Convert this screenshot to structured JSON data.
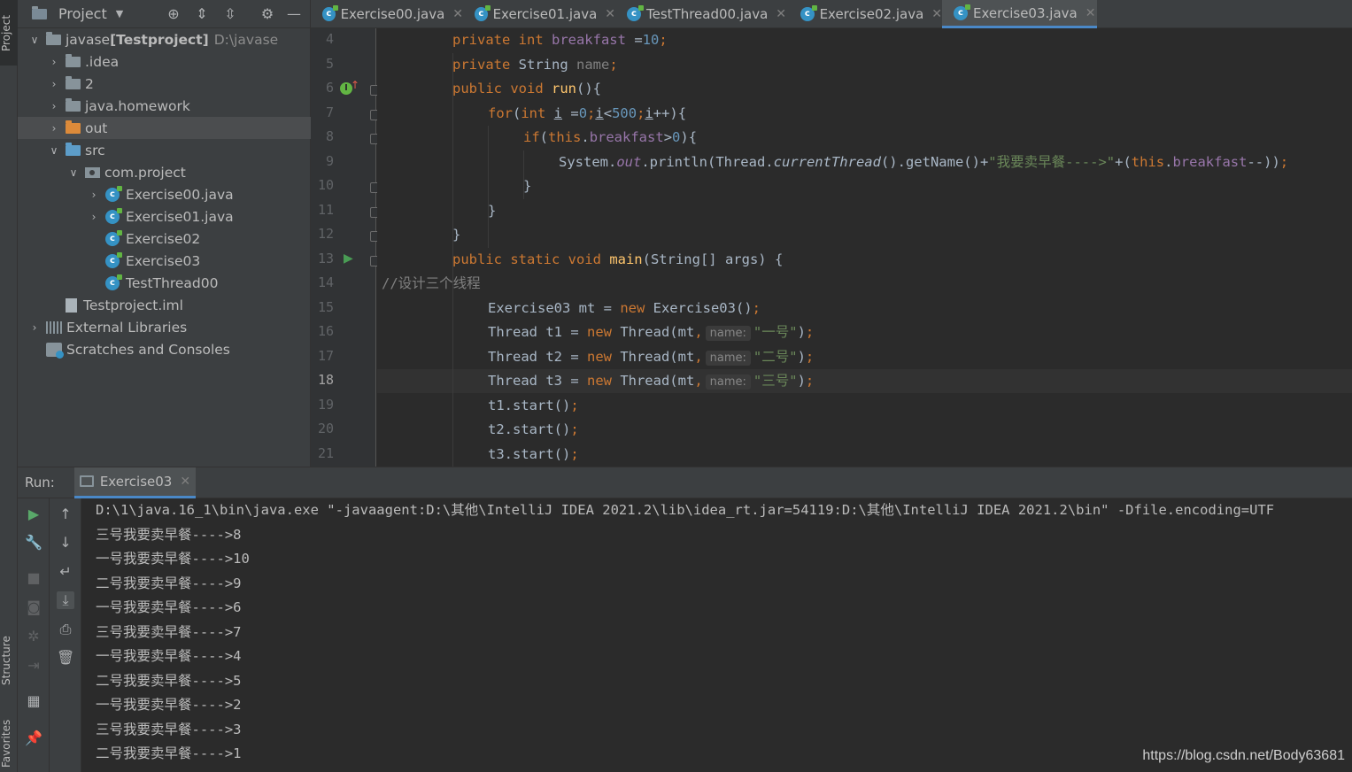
{
  "left_stripe": {
    "project": "Project",
    "structure": "Structure",
    "favorites": "Favorites"
  },
  "project": {
    "title": "Project",
    "tree": [
      {
        "name": "javase",
        "bold_suffix": "[Testproject]",
        "path": "D:\\javase",
        "icon": "folder-icon"
      },
      {
        "name": ".idea",
        "icon": "folder-icon"
      },
      {
        "name": "2",
        "icon": "folder-icon"
      },
      {
        "name": "java.homework",
        "icon": "folder-icon"
      },
      {
        "name": "out",
        "icon": "excluded-folder-icon"
      },
      {
        "name": "src",
        "icon": "source-folder-icon"
      },
      {
        "name": "com.project",
        "icon": "package-icon"
      },
      {
        "name": "Exercise00.java",
        "icon": "java-class-icon"
      },
      {
        "name": "Exercise01.java",
        "icon": "java-class-icon"
      },
      {
        "name": "Exercise02",
        "icon": "java-class-icon"
      },
      {
        "name": "Exercise03",
        "icon": "java-class-icon"
      },
      {
        "name": "TestThread00",
        "icon": "java-class-icon"
      },
      {
        "name": "Testproject.iml",
        "icon": "module-file-icon"
      },
      {
        "name": "External Libraries",
        "icon": "libraries-icon"
      },
      {
        "name": "Scratches and Consoles",
        "icon": "scratches-icon"
      }
    ]
  },
  "tabs": [
    "Exercise00.java",
    "Exercise01.java",
    "TestThread00.java",
    "Exercise02.java",
    "Exercise03.java"
  ],
  "active_tab": "Exercise03.java",
  "editor": {
    "line_numbers": [
      "4",
      "5",
      "6",
      "7",
      "8",
      "9",
      "10",
      "11",
      "12",
      "13",
      "14",
      "15",
      "16",
      "17",
      "18",
      "19",
      "20",
      "21"
    ],
    "current_line": "18",
    "lines": [
      [
        {
          "c": "k",
          "t": "private int "
        },
        {
          "c": "f",
          "t": "breakfast"
        },
        {
          "t": " ="
        },
        {
          "c": "n",
          "t": "10"
        },
        {
          "c": "k",
          "t": ";"
        }
      ],
      [
        {
          "c": "k",
          "t": "private "
        },
        {
          "t": "String "
        },
        {
          "c": "g",
          "t": "name"
        },
        {
          "c": "k",
          "t": ";"
        }
      ],
      [
        {
          "c": "k",
          "t": "public void "
        },
        {
          "c": "m",
          "t": "run"
        },
        {
          "t": "(){"
        }
      ],
      [
        {
          "c": "k",
          "t": "for"
        },
        {
          "t": "("
        },
        {
          "c": "k",
          "t": "int "
        },
        {
          "c": "u",
          "t": "i"
        },
        {
          "t": " ="
        },
        {
          "c": "n",
          "t": "0"
        },
        {
          "c": "k",
          "t": ";"
        },
        {
          "c": "u",
          "t": "i"
        },
        {
          "t": "<"
        },
        {
          "c": "n",
          "t": "500"
        },
        {
          "c": "k",
          "t": ";"
        },
        {
          "c": "u",
          "t": "i"
        },
        {
          "t": "++){"
        }
      ],
      [
        {
          "c": "k",
          "t": "if"
        },
        {
          "t": "("
        },
        {
          "c": "k",
          "t": "this"
        },
        {
          "t": "."
        },
        {
          "c": "f",
          "t": "breakfast"
        },
        {
          "t": ">"
        },
        {
          "c": "n",
          "t": "0"
        },
        {
          "t": "){"
        }
      ],
      [
        {
          "t": "System."
        },
        {
          "c": "fi",
          "t": "out"
        },
        {
          "t": ".println(Thread."
        },
        {
          "c": "it",
          "t": "currentThread"
        },
        {
          "t": "().getName()+"
        },
        {
          "c": "s",
          "t": "\"我要卖早餐---->\""
        },
        {
          "t": "+("
        },
        {
          "c": "k",
          "t": "this"
        },
        {
          "t": "."
        },
        {
          "c": "f",
          "t": "breakfast"
        },
        {
          "t": "--))"
        },
        {
          "c": "k",
          "t": ";"
        }
      ],
      [
        {
          "t": "}"
        }
      ],
      [
        {
          "t": "}"
        }
      ],
      [
        {
          "t": "}"
        }
      ],
      [
        {
          "c": "k",
          "t": "public static void "
        },
        {
          "c": "m",
          "t": "main"
        },
        {
          "t": "(String[] args) {"
        }
      ],
      [
        {
          "c": "g",
          "t": "//设计三个线程"
        }
      ],
      [
        {
          "t": "Exercise03 mt = "
        },
        {
          "c": "k",
          "t": "new "
        },
        {
          "t": "Exercise03()"
        },
        {
          "c": "k",
          "t": ";"
        }
      ],
      [
        {
          "t": "Thread t1 = "
        },
        {
          "c": "k",
          "t": "new "
        },
        {
          "t": "Thread(mt"
        },
        {
          "c": "k",
          "t": ","
        },
        {
          "c": "hint",
          "t": "name:"
        },
        {
          "c": "s",
          "t": "\"一号\""
        },
        {
          "t": ")"
        },
        {
          "c": "k",
          "t": ";"
        }
      ],
      [
        {
          "t": "Thread t2 = "
        },
        {
          "c": "k",
          "t": "new "
        },
        {
          "t": "Thread(mt"
        },
        {
          "c": "k",
          "t": ","
        },
        {
          "c": "hint",
          "t": "name:"
        },
        {
          "c": "s",
          "t": "\"二号\""
        },
        {
          "t": ")"
        },
        {
          "c": "k",
          "t": ";"
        }
      ],
      [
        {
          "t": "Thread t3 = "
        },
        {
          "c": "k",
          "t": "new "
        },
        {
          "t": "Thread(mt"
        },
        {
          "c": "k",
          "t": ","
        },
        {
          "c": "hint",
          "t": "name:"
        },
        {
          "c": "s",
          "t": "\"三号\""
        },
        {
          "t": ")"
        },
        {
          "c": "k",
          "t": ";"
        }
      ],
      [
        {
          "t": "t1.start()"
        },
        {
          "c": "k",
          "t": ";"
        }
      ],
      [
        {
          "t": "t2.start()"
        },
        {
          "c": "k",
          "t": ";"
        }
      ],
      [
        {
          "t": "t3.start()"
        },
        {
          "c": "k",
          "t": ";"
        }
      ]
    ]
  },
  "run": {
    "label": "Run:",
    "tab": "Exercise03",
    "output": [
      "D:\\1\\java.16_1\\bin\\java.exe \"-javaagent:D:\\其他\\IntelliJ IDEA 2021.2\\lib\\idea_rt.jar=54119:D:\\其他\\IntelliJ IDEA 2021.2\\bin\" -Dfile.encoding=UTF",
      "三号我要卖早餐---->8",
      "一号我要卖早餐---->10",
      "二号我要卖早餐---->9",
      "一号我要卖早餐---->6",
      "三号我要卖早餐---->7",
      "一号我要卖早餐---->4",
      "二号我要卖早餐---->5",
      "一号我要卖早餐---->2",
      "三号我要卖早餐---->3",
      "二号我要卖早餐---->1"
    ]
  },
  "watermark": "https://blog.csdn.net/Body63681"
}
